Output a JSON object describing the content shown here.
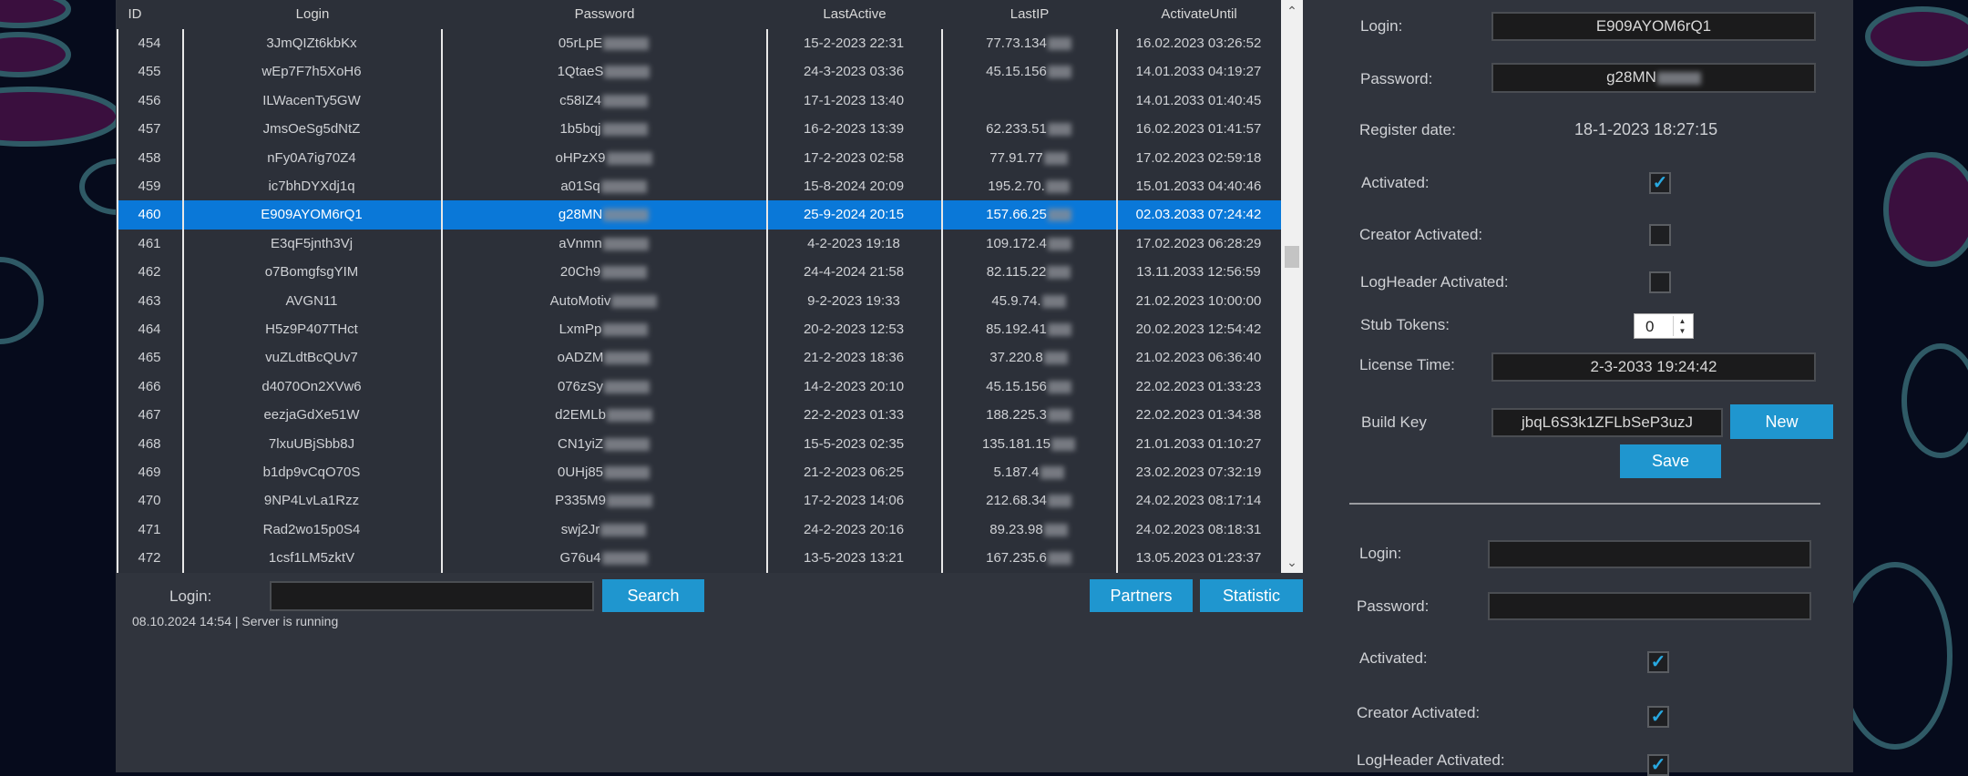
{
  "colors": {
    "accent": "#1f96cf",
    "selection": "#0a78d8",
    "panel": "#30343d",
    "background": "#060b1c"
  },
  "grid": {
    "columns": [
      "ID",
      "Login",
      "Password",
      "LastActive",
      "LastIP",
      "ActivateUntil"
    ],
    "selected_id": "460",
    "rows": [
      [
        "454",
        "3JmQIZt6kbKx",
        "05rLpE",
        "15-2-2023 22:31",
        "77.73.134",
        "16.02.2023 03:26:52"
      ],
      [
        "455",
        "wEp7F7h5XoH6",
        "1QtaeS",
        "24-3-2023 03:36",
        "45.15.156",
        "14.01.2033 04:19:27"
      ],
      [
        "456",
        "ILWacenTy5GW",
        "c58IZ4",
        "17-1-2023 13:40",
        "",
        "14.01.2033 01:40:45"
      ],
      [
        "457",
        "JmsOeSg5dNtZ",
        "1b5bqj",
        "16-2-2023 13:39",
        "62.233.51",
        "16.02.2023 01:41:57"
      ],
      [
        "458",
        "nFy0A7ig70Z4",
        "oHPzX9",
        "17-2-2023 02:58",
        "77.91.77",
        "17.02.2023 02:59:18"
      ],
      [
        "459",
        "ic7bhDYXdj1q",
        "a01Sq",
        "15-8-2024 20:09",
        "195.2.70.",
        "15.01.2033 04:40:46"
      ],
      [
        "460",
        "E909AYOM6rQ1",
        "g28MN",
        "25-9-2024 20:15",
        "157.66.25",
        "02.03.2033 07:24:42"
      ],
      [
        "461",
        "E3qF5jnth3Vj",
        "aVnmn",
        "4-2-2023 19:18",
        "109.172.4",
        "17.02.2023 06:28:29"
      ],
      [
        "462",
        "o7BomgfsgYIM",
        "20Ch9",
        "24-4-2024 21:58",
        "82.115.22",
        "13.11.2033 12:56:59"
      ],
      [
        "463",
        "AVGN11",
        "AutoMotiv",
        "9-2-2023 19:33",
        "45.9.74.",
        "21.02.2023 10:00:00"
      ],
      [
        "464",
        "H5z9P407THct",
        "LxmPp",
        "20-2-2023 12:53",
        "85.192.41",
        "20.02.2023 12:54:42"
      ],
      [
        "465",
        "vuZLdtBcQUv7",
        "oADZM",
        "21-2-2023 18:36",
        "37.220.8",
        "21.02.2023 06:36:40"
      ],
      [
        "466",
        "d4070On2XVw6",
        "076zSy",
        "14-2-2023 20:10",
        "45.15.156",
        "22.02.2023 01:33:23"
      ],
      [
        "467",
        "eezjaGdXe51W",
        "d2EMLb",
        "22-2-2023 01:33",
        "188.225.3",
        "22.02.2023 01:34:38"
      ],
      [
        "468",
        "7lxuUBjSbb8J",
        "CN1yiZ",
        "15-5-2023 02:35",
        "135.181.15",
        "21.01.2033 01:10:27"
      ],
      [
        "469",
        "b1dp9vCqO70S",
        "0UHj85",
        "21-2-2023 06:25",
        "5.187.4",
        "23.02.2023 07:32:19"
      ],
      [
        "470",
        "9NP4LvLa1Rzz",
        "P335M9",
        "17-2-2023 14:06",
        "212.68.34",
        "24.02.2023 08:17:14"
      ],
      [
        "471",
        "Rad2wo15p0S4",
        "swj2Jr",
        "24-2-2023 20:16",
        "89.23.98",
        "24.02.2023 08:18:31"
      ],
      [
        "472",
        "1csf1LM5zktV",
        "G76u4",
        "13-5-2023 13:21",
        "167.235.6",
        "13.05.2023 01:23:37"
      ]
    ]
  },
  "search": {
    "label": "Login:",
    "value": "",
    "button": "Search"
  },
  "buttons": {
    "partners": "Partners",
    "statistic": "Statistic"
  },
  "status": "08.10.2024 14:54 | Server is running",
  "edit": {
    "login_label": "Login:",
    "login_value": "E909AYOM6rQ1",
    "password_label": "Password:",
    "password_value": "g28MN",
    "register_label": "Register date:",
    "register_value": "18-1-2023 18:27:15",
    "activated_label": "Activated:",
    "activated": true,
    "creator_label": "Creator Activated:",
    "creator": false,
    "logheader_label": "LogHeader Activated:",
    "logheader": false,
    "stub_label": "Stub Tokens:",
    "stub_value": "0",
    "license_label": "License Time:",
    "license_value": "2-3-2033 19:24:42",
    "buildkey_label": "Build Key",
    "buildkey_value": "jbqL6S3k1ZFLbSeP3uzJ",
    "new_button": "New",
    "save_button": "Save"
  },
  "create": {
    "login_label": "Login:",
    "login_value": "",
    "password_label": "Password:",
    "password_value": "",
    "activated_label": "Activated:",
    "activated": true,
    "creator_label": "Creator Activated:",
    "creator": true,
    "logheader_label": "LogHeader Activated:",
    "logheader": true
  }
}
